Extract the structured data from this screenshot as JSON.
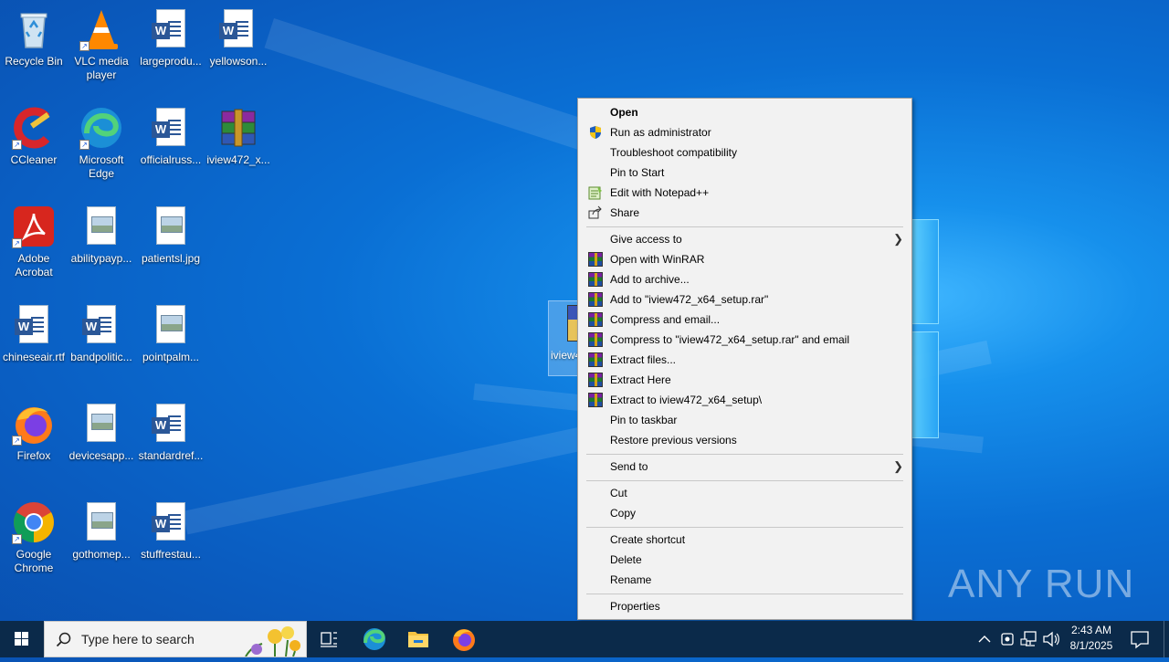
{
  "desktop": {
    "icons": [
      {
        "label": "Recycle Bin"
      },
      {
        "label": "VLC media player"
      },
      {
        "label": "largeprodu..."
      },
      {
        "label": "yellowson..."
      },
      {
        "label": "CCleaner"
      },
      {
        "label": "Microsoft Edge"
      },
      {
        "label": "officialruss..."
      },
      {
        "label": "iview472_x..."
      },
      {
        "label": "Adobe Acrobat"
      },
      {
        "label": "abilitypayp..."
      },
      {
        "label": "patientsl.jpg"
      },
      {
        "label": "chineseair.rtf"
      },
      {
        "label": "bandpolitic..."
      },
      {
        "label": "pointpalm..."
      },
      {
        "label": "Firefox"
      },
      {
        "label": "devicesapp..."
      },
      {
        "label": "standardref..."
      },
      {
        "label": "Google Chrome"
      },
      {
        "label": "gothomep..."
      },
      {
        "label": "stuffrestau..."
      }
    ],
    "selected_icon_label": "iview472_x64_setup"
  },
  "context_menu": {
    "items": [
      {
        "label": "Open"
      },
      {
        "label": "Run as administrator"
      },
      {
        "label": "Troubleshoot compatibility"
      },
      {
        "label": "Pin to Start"
      },
      {
        "label": "Edit with Notepad++"
      },
      {
        "label": "Share"
      },
      {
        "label": "Give access to"
      },
      {
        "label": "Open with WinRAR"
      },
      {
        "label": "Add to archive..."
      },
      {
        "label": "Add to \"iview472_x64_setup.rar\""
      },
      {
        "label": "Compress and email..."
      },
      {
        "label": "Compress to \"iview472_x64_setup.rar\" and email"
      },
      {
        "label": "Extract files..."
      },
      {
        "label": "Extract Here"
      },
      {
        "label": "Extract to iview472_x64_setup\\"
      },
      {
        "label": "Pin to taskbar"
      },
      {
        "label": "Restore previous versions"
      },
      {
        "label": "Send to"
      },
      {
        "label": "Cut"
      },
      {
        "label": "Copy"
      },
      {
        "label": "Create shortcut"
      },
      {
        "label": "Delete"
      },
      {
        "label": "Rename"
      },
      {
        "label": "Properties"
      }
    ]
  },
  "watermark": {
    "text": "ANY RUN"
  },
  "taskbar": {
    "search_placeholder": "Type here to search",
    "time": "2:43 AM",
    "date": "8/1/2025"
  },
  "colors": {
    "taskbar_bg": "#0b2a4a",
    "menu_bg": "#f2f2f2",
    "desktop_accent": "#0a6fd4"
  }
}
